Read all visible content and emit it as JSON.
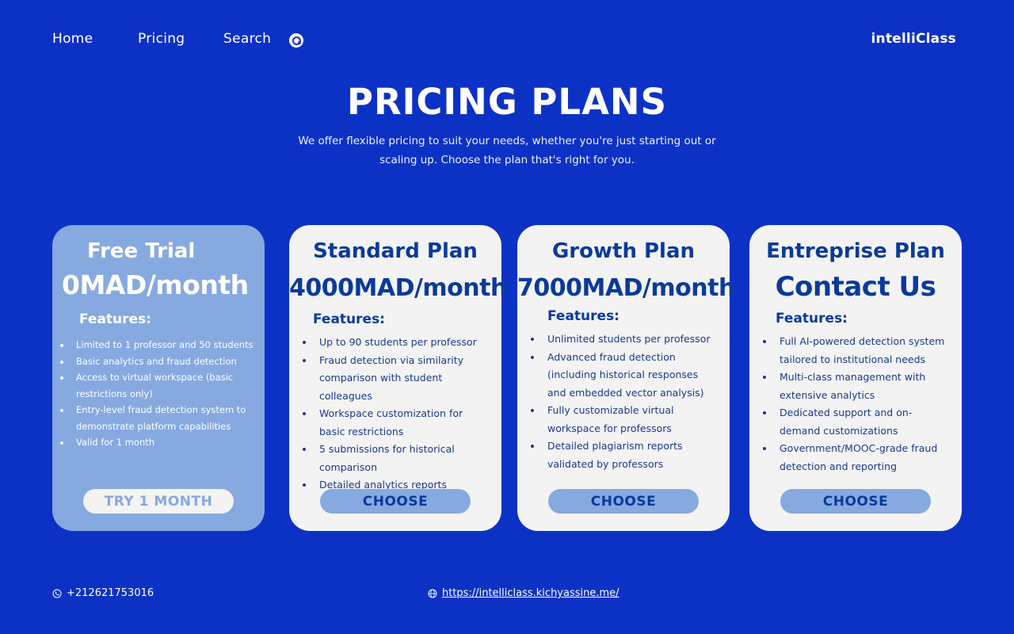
{
  "nav": {
    "home": "Home",
    "pricing": "Pricing",
    "search": "Search",
    "search_icon": "search-icon",
    "brand": "intelliClass"
  },
  "hero": {
    "title": "PRICING PLANS",
    "subtitle": "We offer flexible pricing to suit your needs, whether you're just starting out or scaling up. Choose the plan that's right for you."
  },
  "plans": [
    {
      "name": "Free Trial",
      "price": "0MAD/month",
      "features_label": "Features:",
      "features": [
        "Limited to 1 professor and 50 students",
        "Basic analytics and fraud detection",
        "Access to virtual workspace (basic restrictions only)",
        "Entry-level fraud detection system to demonstrate platform capabilities",
        "Valid for 1 month"
      ],
      "cta": "TRY 1 MONTH"
    },
    {
      "name": "Standard Plan",
      "price": "4000MAD/month",
      "features_label": "Features:",
      "features": [
        "Up to 90 students per professor",
        "Fraud detection via similarity comparison with student colleagues",
        "Workspace customization for basic restrictions",
        "5 submissions for historical comparison",
        "Detailed analytics reports"
      ],
      "cta": "CHOOSE"
    },
    {
      "name": "Growth Plan",
      "price": "7000MAD/month",
      "features_label": "Features:",
      "features": [
        "Unlimited students per professor",
        "Advanced fraud detection (including historical responses and embedded vector analysis)",
        "Fully customizable virtual workspace for professors",
        "Detailed plagiarism reports validated by professors"
      ],
      "cta": "CHOOSE"
    },
    {
      "name": "Entreprise Plan",
      "price": "Contact Us",
      "features_label": "Features:",
      "features": [
        "Full AI-powered detection system tailored to institutional needs",
        "Multi-class management with extensive analytics",
        "Dedicated support and on-demand customizations",
        "Government/MOOC-grade fraud detection and reporting"
      ],
      "cta": "CHOOSE"
    }
  ],
  "footer": {
    "phone": "+212621753016",
    "url": "https://intelliclass.kichyassine.me/"
  },
  "colors": {
    "background": "#0c32c5",
    "card": "#f3f3f4",
    "card_free": "#86a9e0",
    "accent_text": "#0a3a9a",
    "button": "#86a9e0"
  }
}
